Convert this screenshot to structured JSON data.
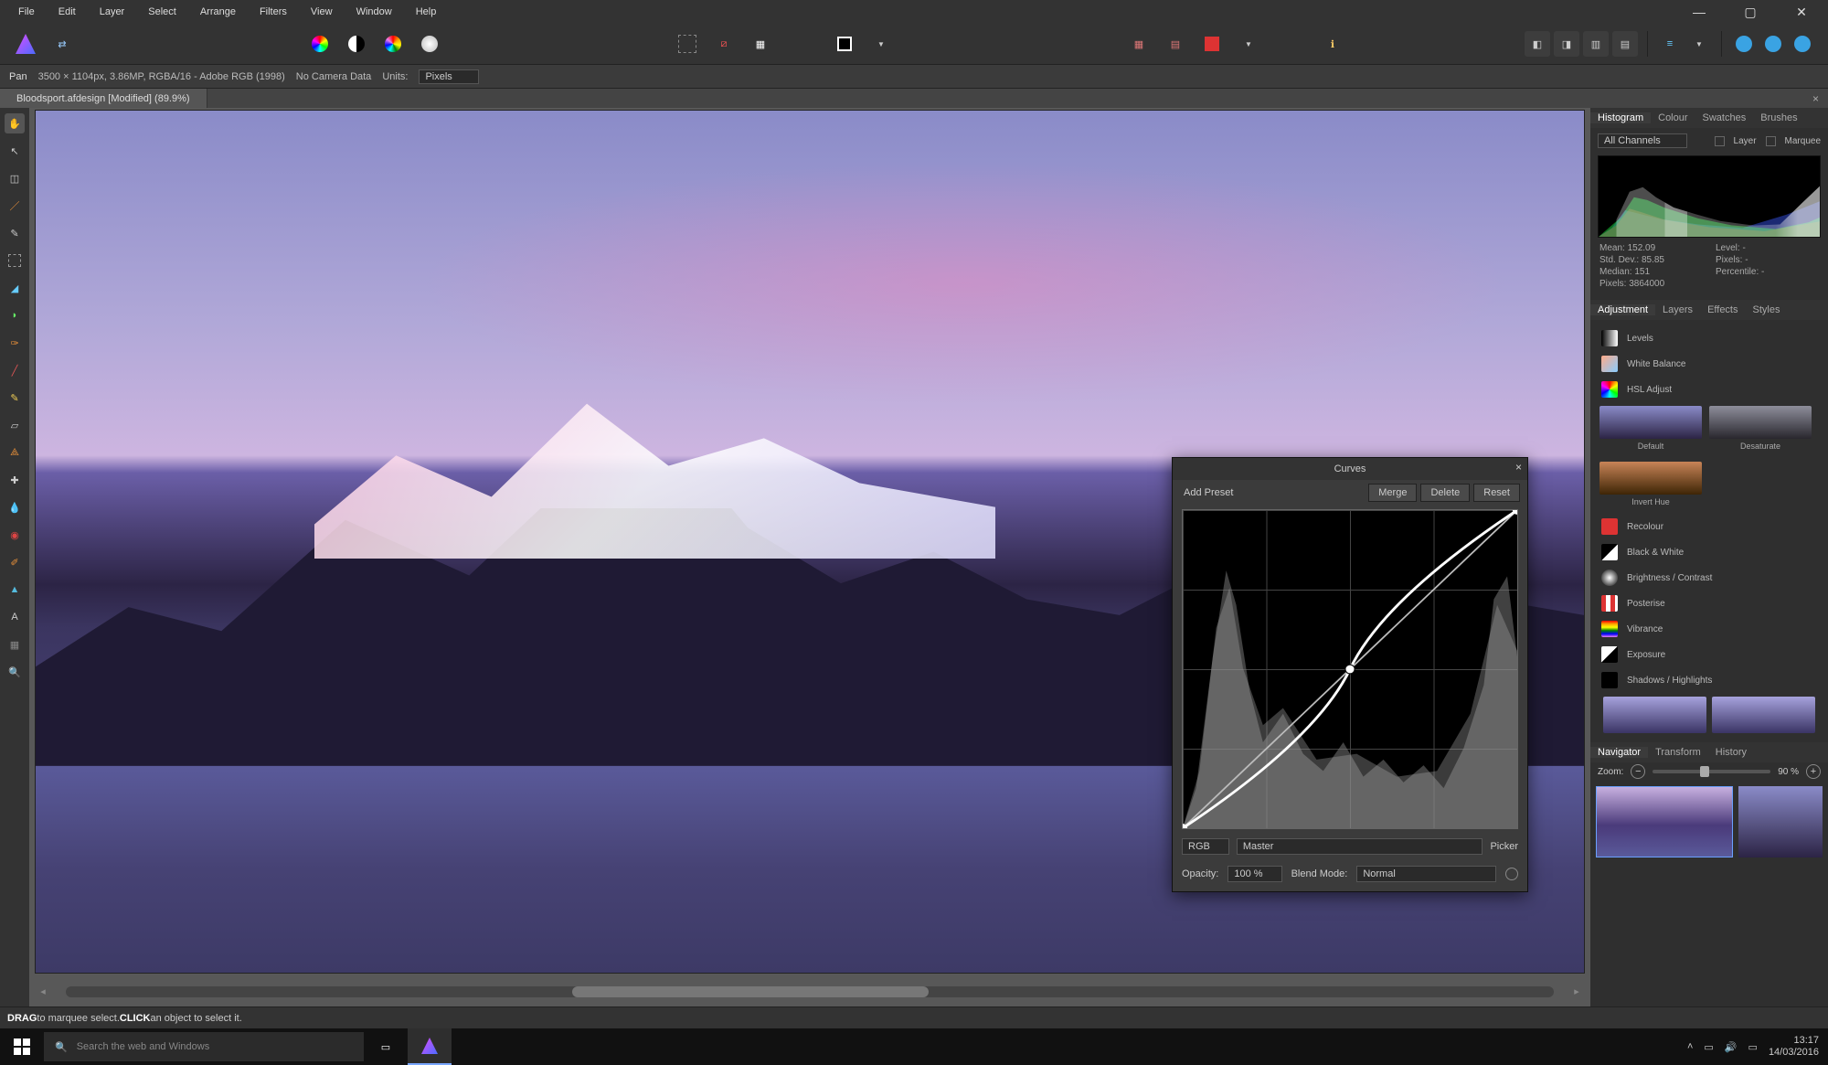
{
  "menu": {
    "items": [
      "File",
      "Edit",
      "Layer",
      "Select",
      "Arrange",
      "Filters",
      "View",
      "Window",
      "Help"
    ]
  },
  "context": {
    "tool": "Pan",
    "info": "3500 × 1104px, 3.86MP, RGBA/16 - Adobe RGB (1998)",
    "camera": "No Camera Data",
    "units_label": "Units:",
    "units_value": "Pixels"
  },
  "tab": {
    "title": "Bloodsport.afdesign [Modified] (89.9%)"
  },
  "hint": {
    "bold1": "DRAG",
    "text1": " to marquee select. ",
    "bold2": "CLICK",
    "text2": " an object to select it."
  },
  "histogram_panel": {
    "tabs": [
      "Histogram",
      "Colour",
      "Swatches",
      "Brushes"
    ],
    "active": 0,
    "channel_label": "All Channels",
    "layer_chk": "Layer",
    "marquee_chk": "Marquee",
    "stats": {
      "mean": "Mean: 152.09",
      "stddev": "Std. Dev.: 85.85",
      "median": "Median: 151",
      "pixels": "Pixels: 3864000",
      "level": "Level: -",
      "pixels2": "Pixels: -",
      "percentile": "Percentile: -"
    }
  },
  "adjust_panel": {
    "tabs": [
      "Adjustment",
      "Layers",
      "Effects",
      "Styles"
    ],
    "active": 0,
    "items": [
      "Levels",
      "White Balance",
      "HSL Adjust",
      "Recolour",
      "Black & White",
      "Brightness / Contrast",
      "Posterise",
      "Vibrance",
      "Exposure",
      "Shadows / Highlights"
    ],
    "presets": [
      "Default",
      "Desaturate",
      "Invert Hue"
    ]
  },
  "nav_panel": {
    "tabs": [
      "Navigator",
      "Transform",
      "History"
    ],
    "active": 0,
    "zoom_label": "Zoom:",
    "zoom_value": "90 %"
  },
  "curves": {
    "title": "Curves",
    "add_preset": "Add Preset",
    "merge": "Merge",
    "delete": "Delete",
    "reset": "Reset",
    "colorspace": "RGB",
    "channel": "Master",
    "picker": "Picker",
    "opacity_label": "Opacity:",
    "opacity_value": "100 %",
    "blend_label": "Blend Mode:",
    "blend_value": "Normal"
  },
  "taskbar": {
    "search_placeholder": "Search the web and Windows",
    "time": "13:17",
    "date": "14/03/2016"
  }
}
